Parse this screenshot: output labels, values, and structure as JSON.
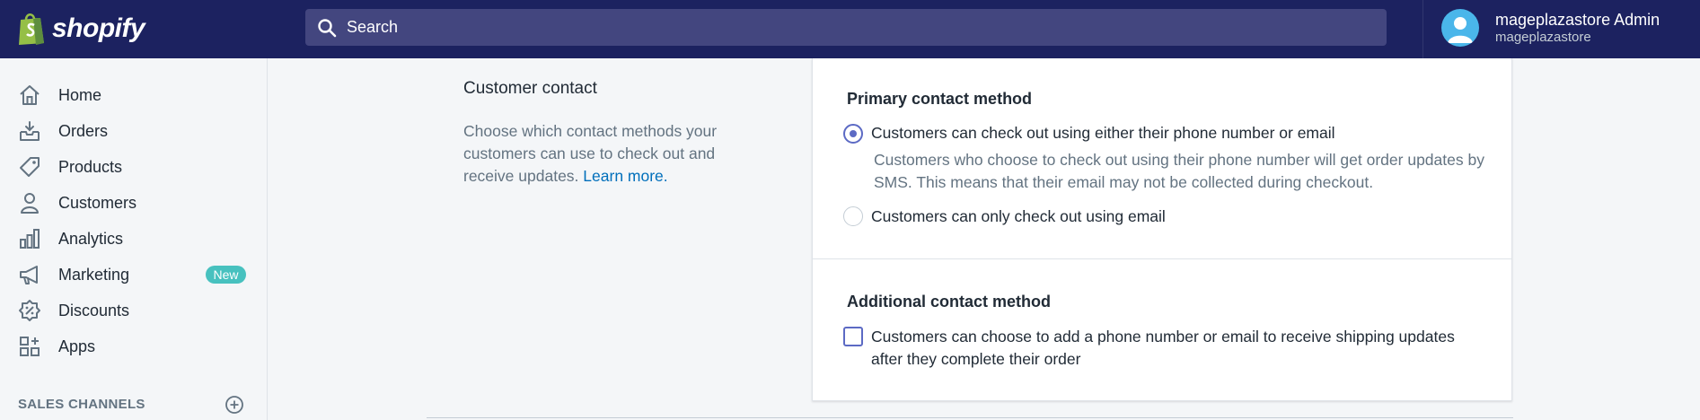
{
  "brand": {
    "name": "shopify"
  },
  "search": {
    "placeholder": "Search"
  },
  "user": {
    "name": "mageplazastore Admin",
    "store": "mageplazastore"
  },
  "sidebar": {
    "items": [
      {
        "label": "Home",
        "icon": "home-icon"
      },
      {
        "label": "Orders",
        "icon": "orders-icon"
      },
      {
        "label": "Products",
        "icon": "tag-icon"
      },
      {
        "label": "Customers",
        "icon": "person-icon"
      },
      {
        "label": "Analytics",
        "icon": "bar-chart-icon"
      },
      {
        "label": "Marketing",
        "icon": "megaphone-icon",
        "badge": "New"
      },
      {
        "label": "Discounts",
        "icon": "discount-icon"
      },
      {
        "label": "Apps",
        "icon": "apps-icon"
      }
    ],
    "sales_channels_title": "SALES CHANNELS"
  },
  "section": {
    "heading": "Customer contact",
    "description": "Choose which contact methods your customers can use to check out and receive updates.",
    "learn_more": "Learn more."
  },
  "primary": {
    "title": "Primary contact method",
    "option1": "Customers can check out using either their phone number or email",
    "option1_help": "Customers who choose to check out using their phone number will get order updates by SMS. This means that their email may not be collected during checkout.",
    "option2": "Customers can only check out using email",
    "selected": 1
  },
  "additional": {
    "title": "Additional contact method",
    "checkbox_label": "Customers can choose to add a phone number or email to receive shipping updates after they complete their order",
    "checked": false
  },
  "colors": {
    "topbar": "#1c2260",
    "accent": "#5c6ac4",
    "badge": "#47c1bf",
    "link": "#006fbb"
  }
}
